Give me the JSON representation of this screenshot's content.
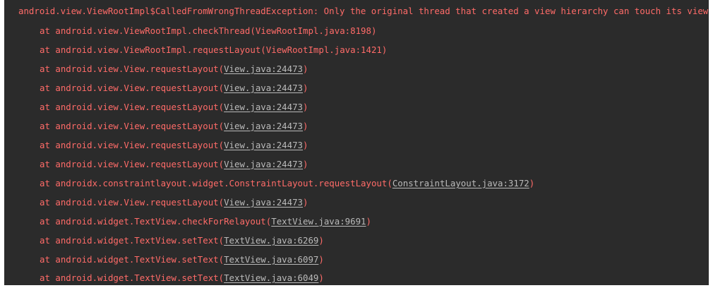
{
  "console": {
    "exception": "android.view.ViewRootImpl$CalledFromWrongThreadException: Only the original thread that created a view hierarchy can touch its views.",
    "frames": [
      {
        "prefix": "at android.view.ViewRootImpl.checkThread(",
        "source": "ViewRootImpl.java:8198",
        "suffix": ")",
        "linked": false
      },
      {
        "prefix": "at android.view.ViewRootImpl.requestLayout(",
        "source": "ViewRootImpl.java:1421",
        "suffix": ")",
        "linked": false
      },
      {
        "prefix": "at android.view.View.requestLayout(",
        "source": "View.java:24473",
        "suffix": ")",
        "linked": true
      },
      {
        "prefix": "at android.view.View.requestLayout(",
        "source": "View.java:24473",
        "suffix": ")",
        "linked": true
      },
      {
        "prefix": "at android.view.View.requestLayout(",
        "source": "View.java:24473",
        "suffix": ")",
        "linked": true
      },
      {
        "prefix": "at android.view.View.requestLayout(",
        "source": "View.java:24473",
        "suffix": ")",
        "linked": true
      },
      {
        "prefix": "at android.view.View.requestLayout(",
        "source": "View.java:24473",
        "suffix": ")",
        "linked": true
      },
      {
        "prefix": "at android.view.View.requestLayout(",
        "source": "View.java:24473",
        "suffix": ")",
        "linked": true
      },
      {
        "prefix": "at androidx.constraintlayout.widget.ConstraintLayout.requestLayout(",
        "source": "ConstraintLayout.java:3172",
        "suffix": ")",
        "linked": true
      },
      {
        "prefix": "at android.view.View.requestLayout(",
        "source": "View.java:24473",
        "suffix": ")",
        "linked": true
      },
      {
        "prefix": "at android.widget.TextView.checkForRelayout(",
        "source": "TextView.java:9691",
        "suffix": ")",
        "linked": true
      },
      {
        "prefix": "at android.widget.TextView.setText(",
        "source": "TextView.java:6269",
        "suffix": ")",
        "linked": true
      },
      {
        "prefix": "at android.widget.TextView.setText(",
        "source": "TextView.java:6097",
        "suffix": ")",
        "linked": true
      },
      {
        "prefix": "at android.widget.TextView.setText(",
        "source": "TextView.java:6049",
        "suffix": ")",
        "linked": true
      }
    ]
  },
  "colors": {
    "background": "#2b2b2b",
    "error_text": "#ff6b68",
    "link_text": "#bababa"
  }
}
